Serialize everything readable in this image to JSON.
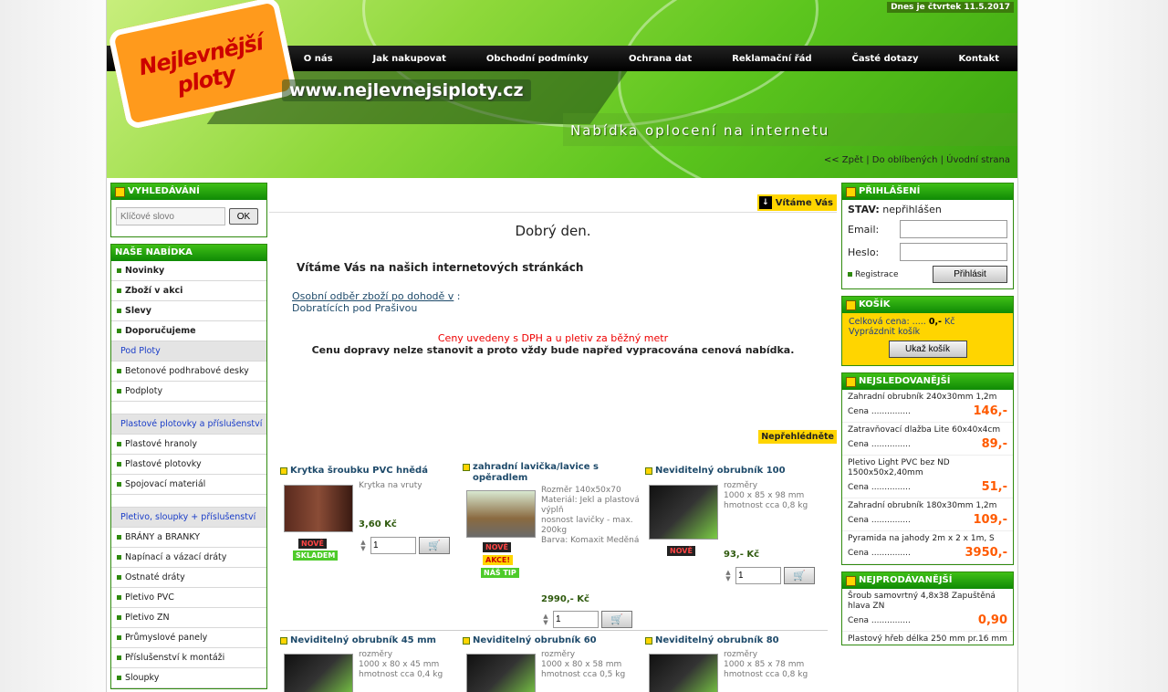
{
  "header": {
    "date_text": "Dnes je čtvrtek 11.5.2017",
    "logo_text": "Nejlevnější ploty",
    "url": "www.nejlevnejsiploty.cz",
    "tagline": "Nabídka oplocení na internetu",
    "nav": [
      "O nás",
      "Jak nakupovat",
      "Obchodní podmínky",
      "Ochrana dat",
      "Reklamační řád",
      "Časté dotazy",
      "Kontakt"
    ],
    "links": {
      "back": "<< Zpět",
      "fav": "Do oblíbených",
      "home": "Úvodní strana"
    }
  },
  "search": {
    "title": "VYHLEDÁVÁNÍ",
    "placeholder": "Klíčové slovo",
    "button": "OK"
  },
  "offer": {
    "title": "NAŠE NABÍDKA",
    "main": [
      "Novinky",
      "Zboží v akci",
      "Slevy",
      "Doporučujeme"
    ],
    "cat1": "Pod Ploty",
    "cat1_items": [
      "Betonové podhrabové desky",
      "Podploty"
    ],
    "cat2": "Plastové plotovky a příslušenství",
    "cat2_items": [
      "Plastové hranoly",
      "Plastové plotovky",
      "Spojovací materiál"
    ],
    "cat3": "Pletivo, sloupky + příslušenství",
    "cat3_items": [
      "BRÁNY a BRANKY",
      "Napínací a vázací dráty",
      "Ostnaté dráty",
      "Pletivo PVC",
      "Pletivo ZN",
      "Průmyslové panely",
      "Příslušenství k montáži",
      "Sloupky"
    ]
  },
  "center": {
    "welcome_tab": "Vítáme Vás",
    "greeting": "Dobrý den.",
    "title": "Vítáme Vás na našich internetových stránkách",
    "pickup_link": "Osobní odběr zboží po dohodě v",
    "pickup_colon": " :",
    "pickup_place": "Dobratících pod Prašivou",
    "price_note": "Ceny uvedeny s DPH a u pletiv za běžný metr",
    "shipping_note": "Cenu dopravy nelze stanovit a proto vždy bude napřed vypracována cenová nabídka.",
    "mustsee_tab": "Nepřehlédněte"
  },
  "products": [
    {
      "title": "Krytka šroubku PVC hnědá",
      "desc": "Krytka na vruty",
      "price": "3,60 Kč",
      "badges": [
        "NOVĚ",
        "SKLADEM"
      ],
      "qty": "1"
    },
    {
      "title": "zahradní lavička/lavice s opěradlem",
      "desc": "Rozměr 140x50x70\nMateriál: Jekl a plastová výplň\nnosnost lavičky - max. 200kg\nBarva: Komaxit Meděná",
      "price": "2990,- Kč",
      "badges": [
        "NOVĚ",
        "AKCE!",
        "NÁŠ TIP"
      ],
      "qty": "1"
    },
    {
      "title": "Neviditelný obrubník 100",
      "desc": "rozměry\n1000 x 85 x 98 mm\nhmotnost cca 0,8 kg",
      "price": "93,- Kč",
      "badges": [
        "NOVĚ"
      ],
      "qty": "1"
    },
    {
      "title": "Neviditelný obrubník 45 mm",
      "desc": "rozměry\n1000 x 80 x 45 mm\nhmotnost cca 0,4 kg"
    },
    {
      "title": "Neviditelný obrubník 60",
      "desc": "rozměry\n1000 x 80 x 58 mm\nhmotnost cca 0,5 kg"
    },
    {
      "title": "Neviditelný obrubník 80",
      "desc": "rozměry\n1000 x 85 x 78 mm\nhmotnost cca 0,8 kg"
    }
  ],
  "login": {
    "title": "PŘIHLÁŠENÍ",
    "status_label": "STAV:",
    "status": "nepřihlášen",
    "email_label": "Email:",
    "password_label": "Heslo:",
    "register": "Registrace",
    "button": "Přihlásit"
  },
  "cart": {
    "title": "KOŠÍK",
    "total_label": "Celková cena: .....",
    "total_value": "0,-",
    "currency": "Kč",
    "empty": "Vyprázdnit košík",
    "button": "Ukaž košík"
  },
  "most_viewed": {
    "title": "NEJSLEDOVANĚJŠÍ",
    "items": [
      {
        "name": "Zahradní obrubník 240x30mm 1,2m",
        "price": "146,-"
      },
      {
        "name": "Zatravňovací dlažba Lite 60x40x4cm",
        "price": "89,-"
      },
      {
        "name": "Pletivo Light PVC bez ND 1500x50x2,40mm",
        "price": "51,-"
      },
      {
        "name": "Zahradní obrubník 180x30mm 1,2m",
        "price": "109,-"
      },
      {
        "name": "Pyramida na jahody 2m x 2 x 1m, S",
        "price": "3950,-"
      }
    ]
  },
  "best_selling": {
    "title": "NEJPRODÁVANĚJŠÍ",
    "items": [
      {
        "name": "Šroub samovrtný 4,8x38 Zapuštěná hlava ZN",
        "price": "0,90"
      },
      {
        "name": "Plastový hřeb délka 250 mm pr.16 mm",
        "price": ""
      }
    ]
  },
  "price_label": "Cena ...............",
  "colors": {
    "brand_green": "#2f8a0e",
    "accent_yellow": "#ffd500",
    "price_orange": "#ff5a00",
    "price_red": "#e00000"
  }
}
